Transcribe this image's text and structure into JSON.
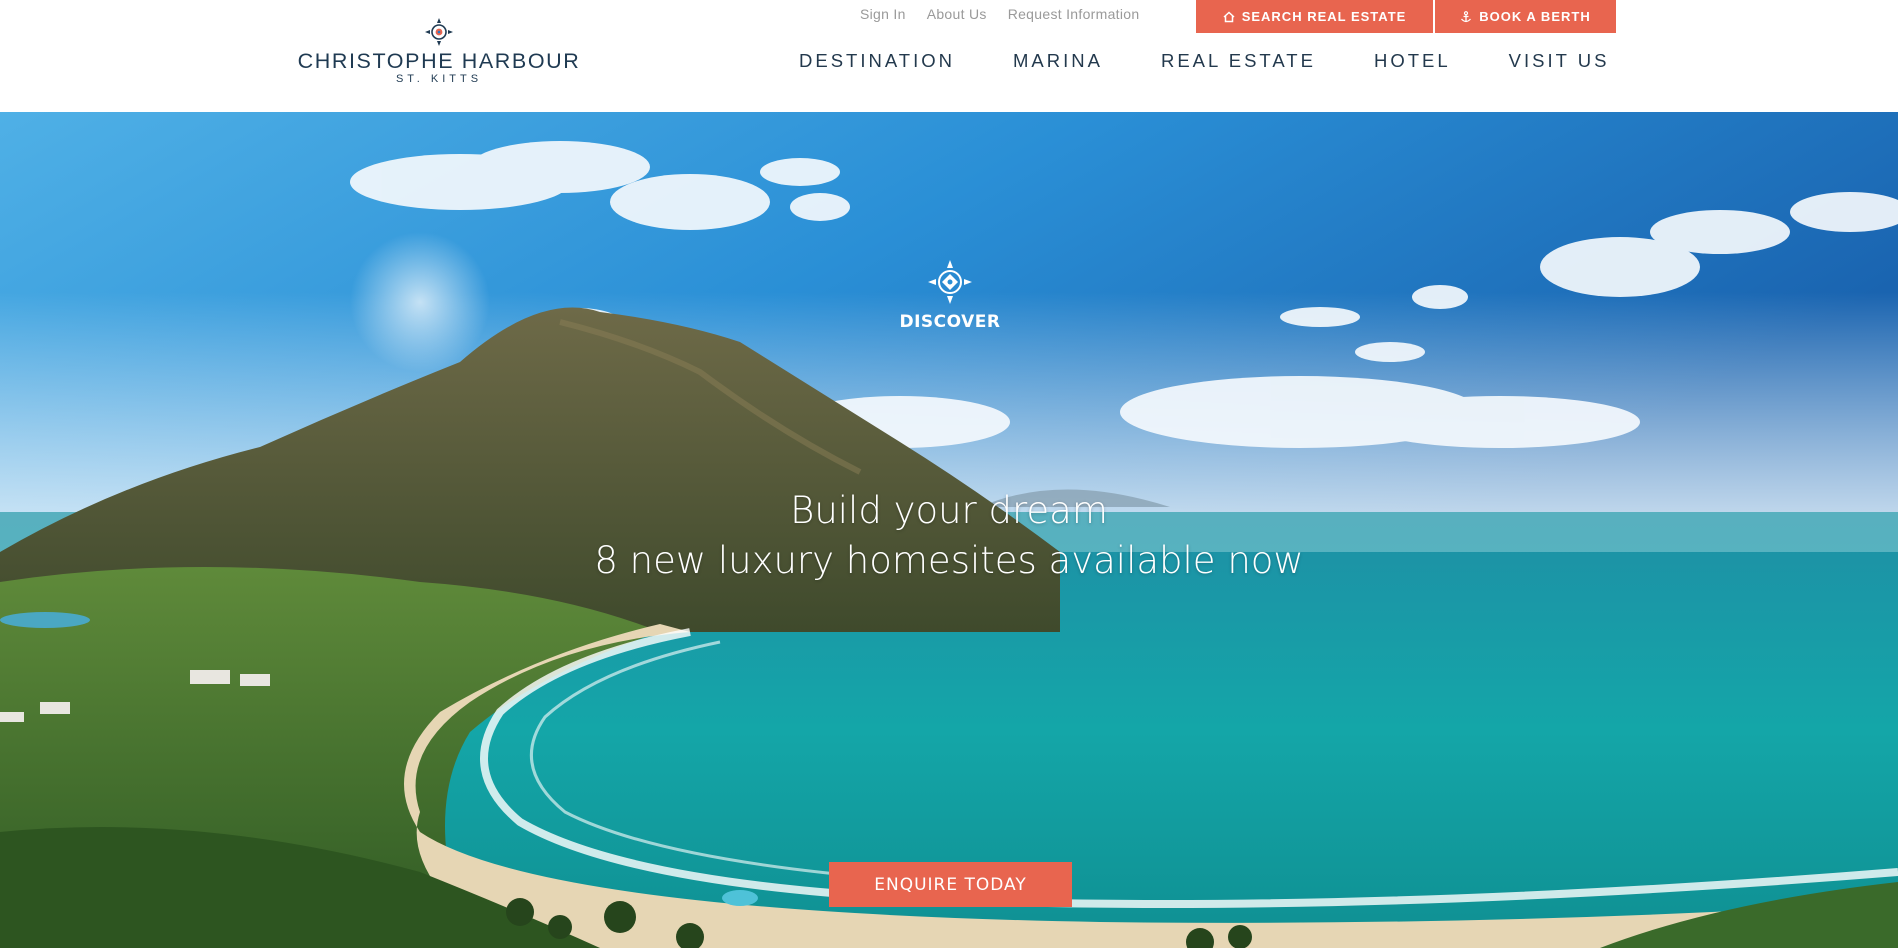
{
  "logo": {
    "name": "CHRISTOPHE HARBOUR",
    "sub": "ST. KITTS",
    "icon": "compass-rose-icon"
  },
  "utility_links": [
    "Sign In",
    "About Us",
    "Request Information"
  ],
  "cta": {
    "search": {
      "label": "SEARCH REAL ESTATE",
      "icon": "home-icon"
    },
    "berth": {
      "label": "BOOK A BERTH",
      "icon": "anchor-icon"
    }
  },
  "nav": [
    "DESTINATION",
    "MARINA",
    "REAL ESTATE",
    "HOTEL",
    "VISIT US"
  ],
  "hero": {
    "discover": "DISCOVER",
    "headline_1": "Build your dream",
    "headline_2": "8 new luxury homesites available now",
    "button": "ENQUIRE TODAY",
    "image": "aerial-beach-bay-icon"
  },
  "colors": {
    "accent": "#e8654f",
    "navy": "#1f3a52",
    "muted": "#9a9a9a"
  }
}
